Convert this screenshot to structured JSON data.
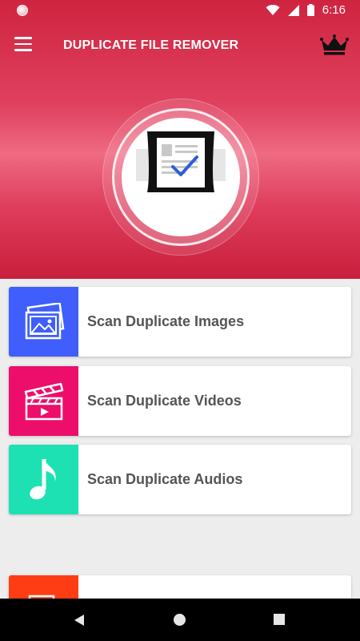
{
  "status_bar": {
    "time": "6:16",
    "icons": [
      "notification-dot-icon",
      "wifi-icon",
      "cellular-signal-icon",
      "battery-icon"
    ]
  },
  "toolbar": {
    "title": "DUPLICATE FILE REMOVER",
    "menu_icon": "hamburger-menu-icon",
    "premium_icon": "crown-icon"
  },
  "hero": {
    "logo_icon": "duplicate-document-check-icon"
  },
  "cards": [
    {
      "label": "Scan Duplicate Images",
      "icon": "image-gallery-icon",
      "color": "#3f5efb"
    },
    {
      "label": "Scan Duplicate Videos",
      "icon": "video-clapperboard-icon",
      "color": "#ed0e6b"
    },
    {
      "label": "Scan Duplicate Audios",
      "icon": "music-note-icon",
      "color": "#1de1b3"
    },
    {
      "label": "",
      "icon": "document-stack-icon",
      "color": "#ff3d14"
    }
  ],
  "colors": {
    "primary": "#d6294a",
    "background": "#ededed"
  },
  "nav_bar": {
    "icons": [
      "back-icon",
      "home-icon",
      "recents-icon"
    ]
  }
}
